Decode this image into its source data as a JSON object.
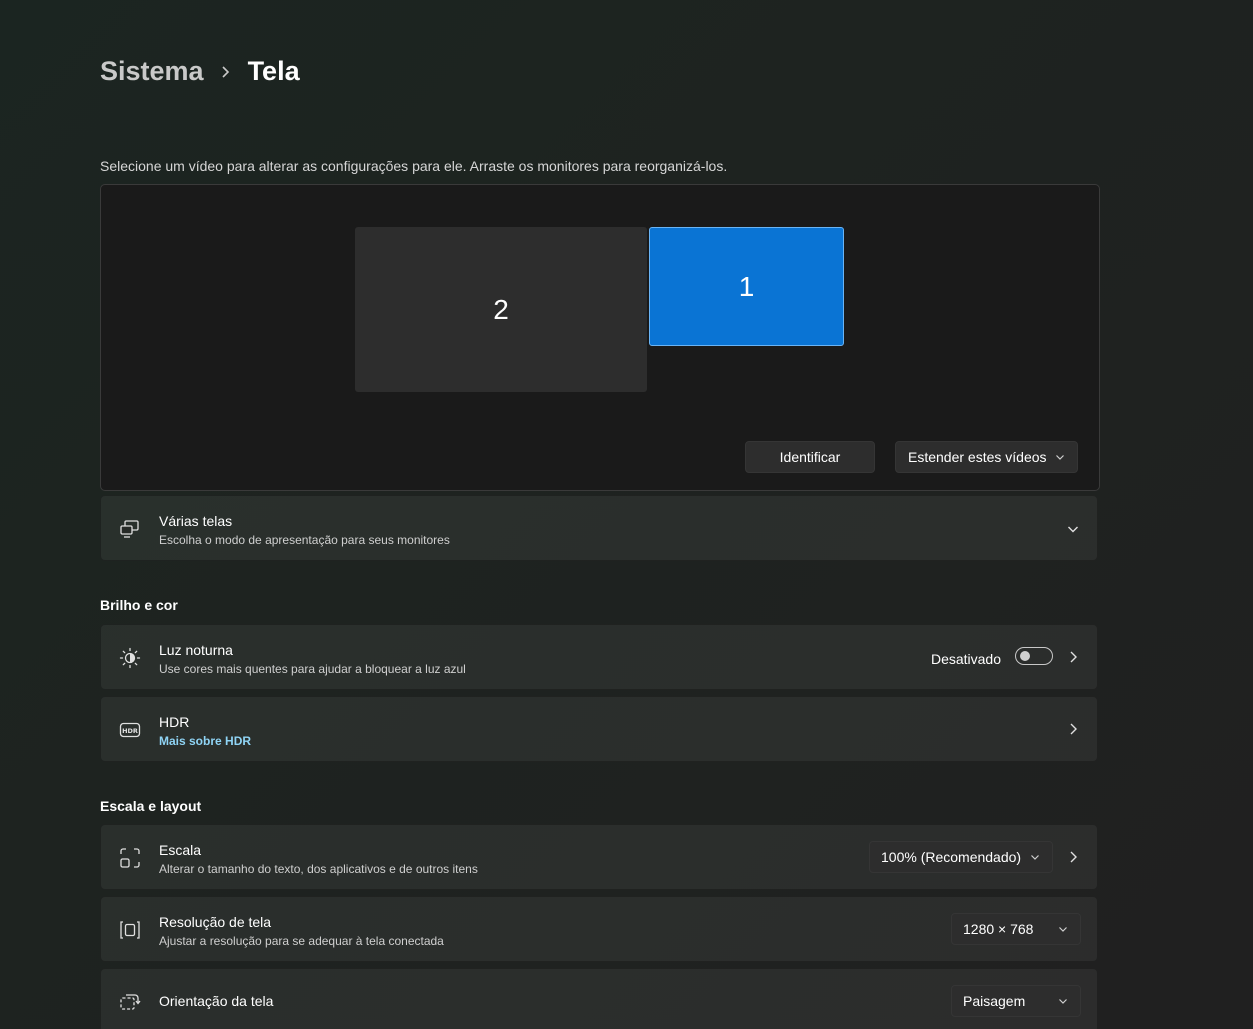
{
  "breadcrumb": {
    "parent": "Sistema",
    "current": "Tela"
  },
  "instruction": "Selecione um vídeo para alterar as configurações para ele. Arraste os monitores para reorganizá-los.",
  "arrangement": {
    "monitors": [
      {
        "label": "2",
        "selected": false
      },
      {
        "label": "1",
        "selected": true
      }
    ],
    "identify_label": "Identificar",
    "mode_label": "Estender estes vídeos"
  },
  "multiple_displays": {
    "title": "Várias telas",
    "subtitle": "Escolha o modo de apresentação para seus monitores",
    "icon": "multiple-displays-icon"
  },
  "brightness_section": {
    "heading": "Brilho e cor",
    "night_light": {
      "title": "Luz noturna",
      "subtitle": "Use cores mais quentes para ajudar a bloquear a luz azul",
      "status": "Desativado",
      "enabled": false,
      "icon": "night-light-icon"
    },
    "hdr": {
      "title": "HDR",
      "link": "Mais sobre HDR",
      "icon": "hdr-icon"
    }
  },
  "scale_section": {
    "heading": "Escala e layout",
    "scale": {
      "title": "Escala",
      "subtitle": "Alterar o tamanho do texto, dos aplicativos e de outros itens",
      "value": "100% (Recomendado)",
      "icon": "scale-icon"
    },
    "resolution": {
      "title": "Resolução de tela",
      "subtitle": "Ajustar a resolução para se adequar à tela conectada",
      "value": "1280 × 768",
      "icon": "resolution-icon"
    },
    "orientation": {
      "title": "Orientação da tela",
      "value": "Paisagem",
      "icon": "orientation-icon"
    }
  },
  "colors": {
    "accent": "#0a74d4",
    "link": "#8fd4f5",
    "card": "#2b2b2b"
  }
}
